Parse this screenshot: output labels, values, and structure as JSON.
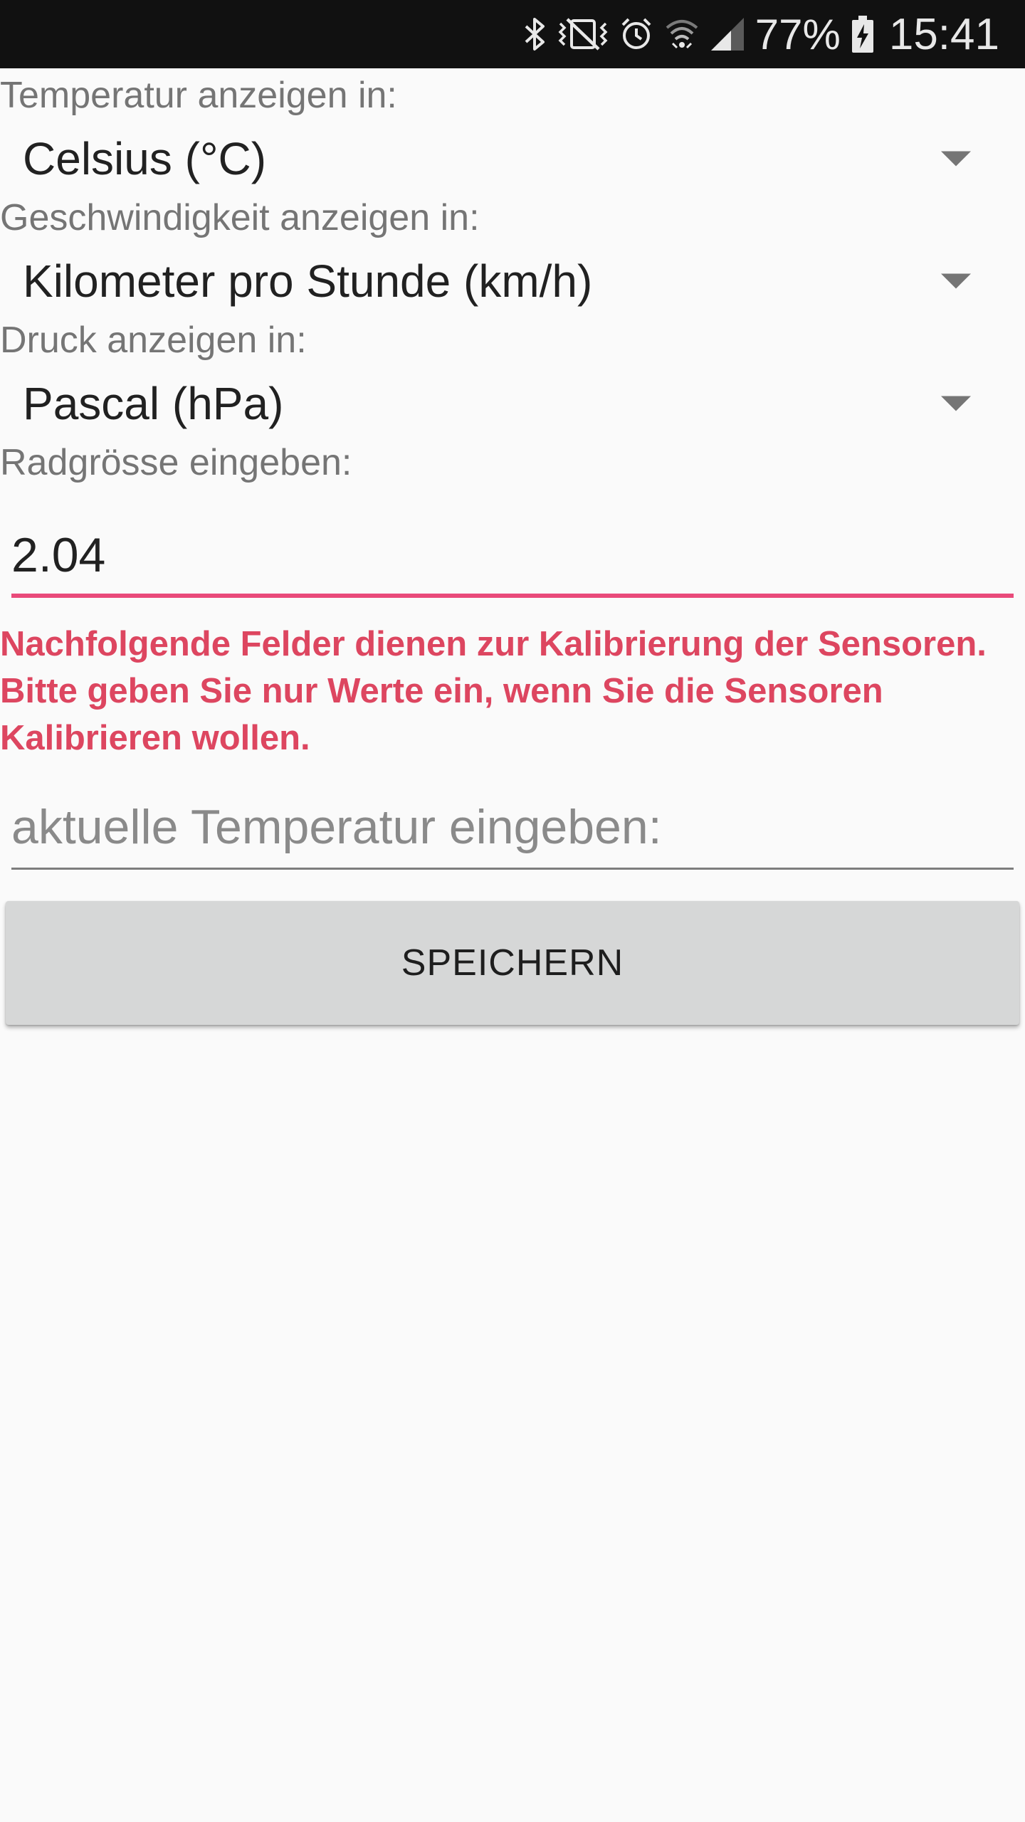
{
  "status_bar": {
    "icons": [
      "bluetooth-icon",
      "vibrate-mute-icon",
      "alarm-icon",
      "wifi-icon",
      "signal-icon"
    ],
    "battery_percent": "77%",
    "battery_icon": "battery-charging-icon",
    "time": "15:41"
  },
  "settings": {
    "temperature": {
      "label": "Temperatur anzeigen in:",
      "selected": "Celsius (°C)"
    },
    "speed": {
      "label": "Geschwindigkeit anzeigen in:",
      "selected": "Kilometer pro Stunde (km/h)"
    },
    "pressure": {
      "label": "Druck anzeigen in:",
      "selected": "Pascal (hPa)"
    },
    "wheel_size": {
      "label": "Radgrösse eingeben:",
      "value": "2.04"
    }
  },
  "calibration": {
    "warning": "Nachfolgende Felder dienen zur Kalibrierung der Sensoren. Bitte geben Sie nur Werte ein, wenn Sie die Sensoren Kalibrieren wollen.",
    "temperature_placeholder": "aktuelle Temperatur eingeben:"
  },
  "actions": {
    "save_label": "SPEICHERN"
  },
  "colors": {
    "accent": "#e94a7a",
    "warning_text": "#dd4660",
    "status_bar": "#111111",
    "background": "#fafafa",
    "button": "#d6d7d7"
  }
}
